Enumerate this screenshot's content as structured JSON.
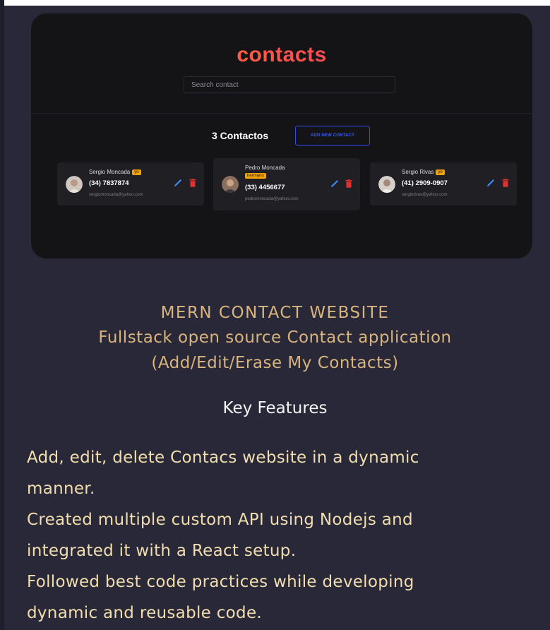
{
  "app": {
    "title": "contacts",
    "search": {
      "placeholder": "Search contact",
      "value": ""
    },
    "count_label": "3 Contactos",
    "add_button_label": "ADD NEW CONTACT",
    "contacts": [
      {
        "name": "Sergio Moncada",
        "badge": "yo",
        "phone": "(34) 7837874",
        "email": "sergiomoncada@yahoo.com",
        "avatar": "person-avatar"
      },
      {
        "name": "Pedro Moncada",
        "badge": "hermano",
        "phone": "(33) 4456677",
        "email": "pedromoncada@yahoo.com",
        "avatar": "person-avatar"
      },
      {
        "name": "Sergio Rivas",
        "badge": "yo",
        "phone": "(41) 2909-0907",
        "email": "sergiorivas@yahoo.com",
        "avatar": "person-avatar"
      }
    ],
    "icons": {
      "edit": "pencil-icon",
      "delete": "trash-icon"
    },
    "colors": {
      "edit": "#3b8cff",
      "delete": "#e0302f",
      "badge": "#f5a300",
      "accent": "#2d4bff"
    }
  },
  "description": {
    "title": "MERN CONTACT WEBSITE",
    "subtitle_line1": "Fullstack open source Contact application",
    "subtitle_line2": "(Add/Edit/Erase My Contacts)",
    "key_features_heading": "Key Features",
    "features_lines": [
      "Add, edit, delete Contacs website in a dynamic",
      "manner.",
      "Created multiple custom API using Nodejs and",
      "integrated it with a React setup.",
      "Followed best code practices while developing",
      "dynamic and reusable code."
    ],
    "colors": {
      "title": "#d9b47c",
      "features": "#f2ddae"
    }
  }
}
